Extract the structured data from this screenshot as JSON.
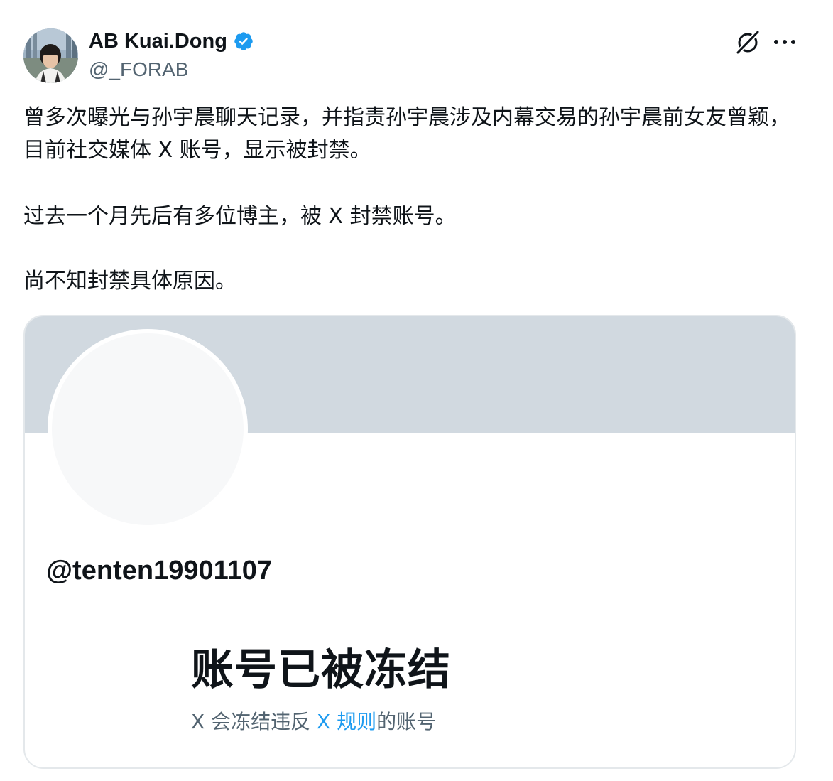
{
  "author": {
    "name": "AB Kuai.Dong",
    "handle": "@_FORAB",
    "verified": true
  },
  "actions": {
    "grok_icon": "grok-icon",
    "more_icon": "more-horizontal-icon"
  },
  "tweet": {
    "paragraph_1": "曾多次曝光与孙宇晨聊天记录，并指责孙宇晨涉及内幕交易的孙宇晨前女友曾颖，目前社交媒体 X 账号，显示被封禁。",
    "paragraph_2": "过去一个月先后有多位博主，被 X 封禁账号。",
    "paragraph_3": "尚不知封禁具体原因。"
  },
  "embedded_card": {
    "handle": "@tenten19901107",
    "title": "账号已被冻结",
    "subtitle_prefix": "X 会冻结违反 ",
    "subtitle_link": "X 规则",
    "subtitle_suffix": "的账号"
  },
  "colors": {
    "text_primary": "#0f1419",
    "text_secondary": "#536471",
    "link": "#1d9bf0",
    "verified_badge": "#1d9bf0",
    "banner": "#d1d9e0",
    "card_border": "#e4e8eb"
  }
}
